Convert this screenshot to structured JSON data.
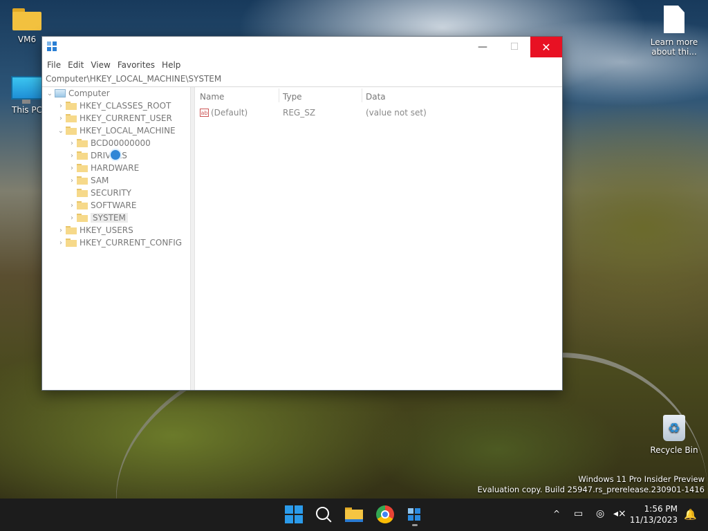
{
  "desktop": {
    "icons": [
      {
        "label": "VM6",
        "kind": "folder"
      },
      {
        "label": "This PC",
        "kind": "pc"
      },
      {
        "label": "Learn more about thi...",
        "kind": "document"
      },
      {
        "label": "Recycle Bin",
        "kind": "recycle-bin"
      }
    ],
    "watermark": {
      "line1": "Windows 11 Pro Insider Preview",
      "line2": "Evaluation copy. Build 25947.rs_prerelease.230901-1416"
    }
  },
  "window": {
    "title_icon": "regedit-icon",
    "controls": {
      "minimize": "—",
      "maximize": "☐",
      "close": "✕"
    },
    "menu": [
      "File",
      "Edit",
      "View",
      "Favorites",
      "Help"
    ],
    "address": "Computer\\HKEY_LOCAL_MACHINE\\SYSTEM",
    "tree": {
      "root": "Computer",
      "hives": [
        {
          "label": "HKEY_CLASSES_ROOT",
          "expanded": false
        },
        {
          "label": "HKEY_CURRENT_USER",
          "expanded": false
        },
        {
          "label": "HKEY_LOCAL_MACHINE",
          "expanded": true,
          "children": [
            "BCD00000000",
            "DRIVERS",
            "HARDWARE",
            "SAM",
            "SECURITY",
            "SOFTWARE",
            "SYSTEM"
          ],
          "selected": "SYSTEM"
        },
        {
          "label": "HKEY_USERS",
          "expanded": false
        },
        {
          "label": "HKEY_CURRENT_CONFIG",
          "expanded": false
        }
      ]
    },
    "list": {
      "columns": [
        "Name",
        "Type",
        "Data"
      ],
      "rows": [
        {
          "name": "(Default)",
          "type": "REG_SZ",
          "data": "(value not set)"
        }
      ]
    }
  },
  "taskbar": {
    "apps": [
      "start-icon",
      "search-icon",
      "file-explorer-icon",
      "chrome-icon",
      "regedit-icon"
    ],
    "tray": {
      "chevron": "^",
      "time": "1:56 PM",
      "date": "11/13/2023"
    }
  },
  "colors": {
    "accent": "#2b9bea",
    "close": "#e81123",
    "taskbar": "#1c1c1c"
  }
}
